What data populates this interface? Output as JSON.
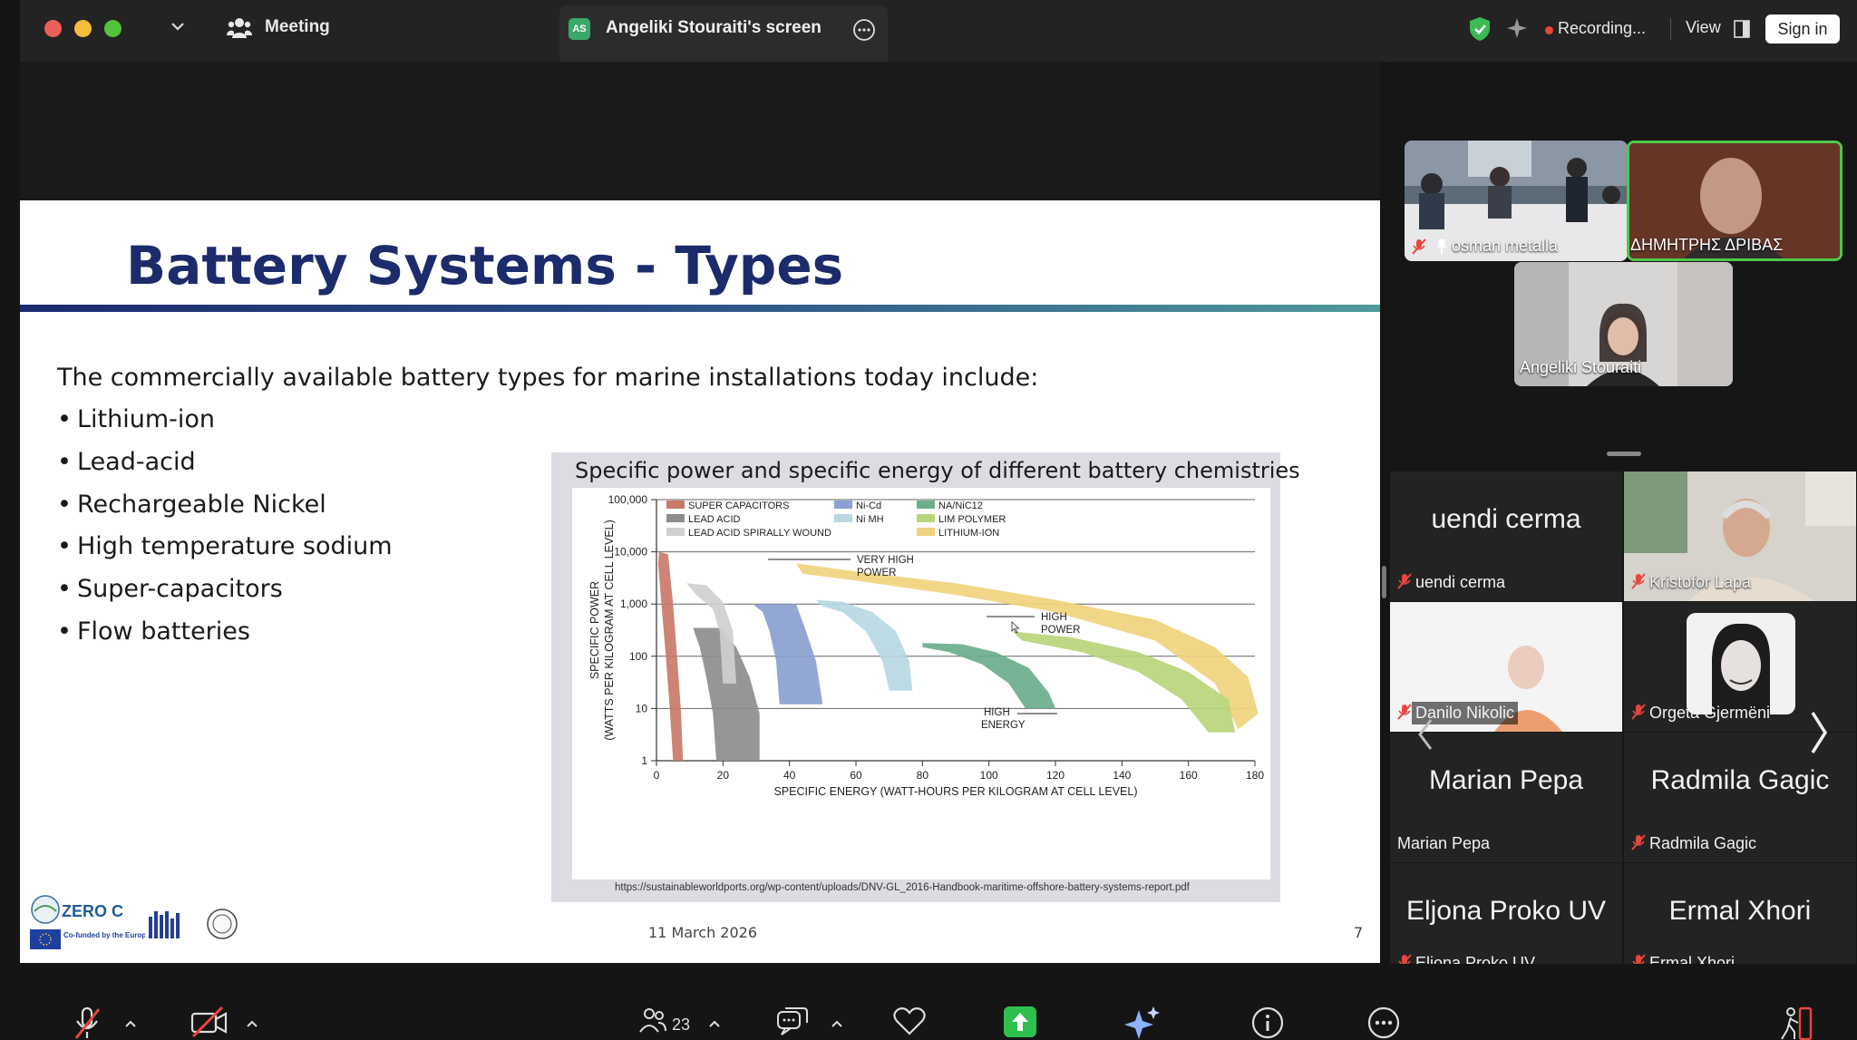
{
  "window": {
    "meeting_label": "Meeting",
    "screen_share_badge": "AS",
    "screen_share_label": "Angeliki Stouraiti's screen",
    "recording_label": "Recording...",
    "view_label": "View",
    "signin_label": "Sign in"
  },
  "slide": {
    "title": "Battery Systems - Types",
    "intro": "The commercially available battery types for marine installations today include:",
    "bullets": [
      "Lithium-ion",
      "Lead-acid",
      "Rechargeable Nickel",
      "High temperature sodium",
      "Super-capacitors",
      "Flow batteries"
    ],
    "figure_title": "Specific power and specific energy of different battery chemistries",
    "figure_source": "https://sustainableworldports.org/wp-content/uploads/DNV-GL_2016-Handbook-maritime-offshore-battery-systems-report.pdf",
    "date": "11 March 2026",
    "page_number": "7",
    "logo_text": {
      "zeroc": "ZERO C",
      "eu": "Co-funded by the European Union"
    }
  },
  "chart_data": {
    "type": "area",
    "ylabel": "SPECIFIC POWER (WATTS PER KILOGRAM AT CELL LEVEL)",
    "xlabel": "SPECIFIC ENERGY (WATT-HOURS PER KILOGRAM AT CELL LEVEL)",
    "x_ticks": [
      "0",
      "20",
      "40",
      "60",
      "80",
      "100",
      "120",
      "140",
      "160",
      "180"
    ],
    "y_ticks": [
      "1",
      "10",
      "100",
      "1,000",
      "10,000",
      "100,000"
    ],
    "xlim": [
      0,
      180
    ],
    "ylim": [
      1,
      100000
    ],
    "y_scale": "log",
    "grid": true,
    "legend": [
      {
        "name": "SUPER CAPACITORS",
        "color": "#c97a68"
      },
      {
        "name": "LEAD ACID",
        "color": "#8d8d8f"
      },
      {
        "name": "LEAD ACID SPIRALLY WOUND",
        "color": "#cfcfd1"
      },
      {
        "name": "Ni-Cd",
        "color": "#8aa0d0"
      },
      {
        "name": "Ni MH",
        "color": "#b6d8e3"
      },
      {
        "name": "NA/NiC12",
        "color": "#6aae8c"
      },
      {
        "name": "LIM POLYMER",
        "color": "#b9d57c"
      },
      {
        "name": "LITHIUM-ION",
        "color": "#f1d27e"
      }
    ],
    "series": [
      {
        "name": "SUPER CAPACITORS",
        "energy_range": [
          1,
          8
        ],
        "power_range": [
          1,
          10000
        ]
      },
      {
        "name": "LEAD ACID",
        "energy_range": [
          12,
          35
        ],
        "power_range": [
          1,
          300
        ]
      },
      {
        "name": "LEAD ACID SPIRALLY WOUND",
        "energy_range": [
          10,
          25
        ],
        "power_range": [
          30,
          2000
        ]
      },
      {
        "name": "Ni-Cd",
        "energy_range": [
          30,
          55
        ],
        "power_range": [
          10,
          1000
        ]
      },
      {
        "name": "Ni MH",
        "energy_range": [
          50,
          82
        ],
        "power_range": [
          20,
          1200
        ]
      },
      {
        "name": "NA/NiC12",
        "energy_range": [
          80,
          120
        ],
        "power_range": [
          10,
          200
        ]
      },
      {
        "name": "LIM POLYMER",
        "energy_range": [
          105,
          170
        ],
        "power_range": [
          3,
          300
        ]
      },
      {
        "name": "LITHIUM-ION",
        "energy_range": [
          40,
          180
        ],
        "power_range": [
          3,
          8000
        ]
      }
    ],
    "annotations": [
      "VERY HIGH POWER",
      "HIGH POWER",
      "HIGH ENERGY"
    ]
  },
  "participants": {
    "speakers": [
      {
        "name": "osman metalla",
        "pinned": true,
        "muted": true
      },
      {
        "name": "ΔΗΜΗΤΡΗΣ ΔΡΙΒΑΣ",
        "active": true
      },
      {
        "name": "Angeliki Stouraiti"
      }
    ],
    "gallery": [
      {
        "big": "uendi cerma",
        "name": "uendi cerma",
        "muted": true
      },
      {
        "big": "",
        "name": "Kristofor Lapa",
        "muted": true
      },
      {
        "big": "",
        "name": "Danilo Nikolic",
        "muted": true
      },
      {
        "big": "",
        "name": "Orgeta Gjermëni",
        "muted": true
      },
      {
        "big": "Marian Pepa",
        "name": "Marian Pepa",
        "muted": false
      },
      {
        "big": "Radmila Gagic",
        "name": "Radmila Gagic",
        "muted": true
      },
      {
        "big": "Eljona Proko UV",
        "name": "Eljona Proko UV",
        "muted": true
      },
      {
        "big": "Ermal Xhori",
        "name": "Ermal Xhori",
        "muted": true
      }
    ]
  },
  "toolbar": {
    "participants_count": "23"
  },
  "colors": {
    "title": "#1c2b6b",
    "active_speaker_border": "#4fc84a",
    "mute_red": "#e8463d",
    "share_green": "#2fbf4e"
  }
}
